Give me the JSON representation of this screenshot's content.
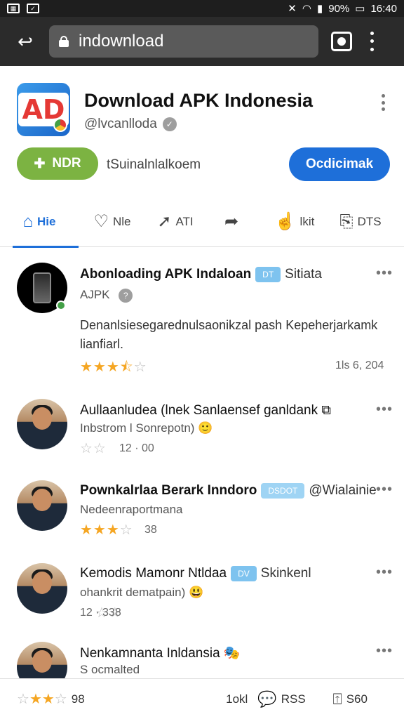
{
  "status_bar": {
    "time": "16:40",
    "battery": "90%",
    "left_icons": [
      "image-icon",
      "notification-icon"
    ],
    "right_icons": [
      "mute-icon",
      "wifi-icon",
      "signal-icon",
      "battery-icon"
    ]
  },
  "browser": {
    "url": "indownload"
  },
  "header": {
    "title": "Download APK Indonesia",
    "handle": "@lvcanlloda",
    "follow_label": "NDR",
    "tagline": "tSuinalnlalkoem",
    "download_label": "Ocdicimak"
  },
  "tabs": [
    {
      "label": "Hie",
      "icon": "home-icon",
      "active": true
    },
    {
      "label": "Nle",
      "icon": "comment-icon",
      "active": false
    },
    {
      "label": "ATI",
      "icon": "share-icon",
      "active": false
    },
    {
      "label": "",
      "icon": "forward-icon",
      "active": false
    },
    {
      "label": "lkit",
      "icon": "like-icon",
      "active": false
    },
    {
      "label": "DTS",
      "icon": "thumb-icon",
      "active": false
    }
  ],
  "posts": [
    {
      "title": "Abonloading APK Indaloan",
      "pill": "DT",
      "extra": "Sitiata",
      "sub": "AJPK",
      "body": "Denanlsiesegarednulsaonikzal pash Kepeherjarkamk lianfiarl.",
      "rating": 3.5,
      "meta": "1ls 6, 204"
    },
    {
      "title": "Aullaanludea (lnek Sanlaensef ganldank",
      "extra": "",
      "sub": "Inbstrom l Sonrepotn)",
      "body": "",
      "rating": 1,
      "meta": "12 · 00"
    },
    {
      "title": "Pownkalrlaa Berark Inndoro",
      "pill": "DSDOT",
      "extra": "@Wialainie",
      "sub": "Nedeenraportmana",
      "body": "",
      "rating": 3,
      "meta": "38"
    },
    {
      "title": "Kemodis Mamonr Ntldaa",
      "pill": "DV",
      "extra": "Skinkenl",
      "sub": "ohankrit dematpain)",
      "body": "",
      "rating": 0,
      "meta": "12 · 338"
    },
    {
      "title": "Nenkamnanta Inldansia",
      "extra": "",
      "sub": "S ocmalted",
      "body": "",
      "rating": 0,
      "meta": ""
    }
  ],
  "action_bar": {
    "rating_label": "98",
    "count_label": "1okl",
    "comments_label": "RSS",
    "share_label": "S60"
  },
  "colors": {
    "accent": "#1e6fd9",
    "follow_green": "#7cb342",
    "star": "#f5a623"
  }
}
